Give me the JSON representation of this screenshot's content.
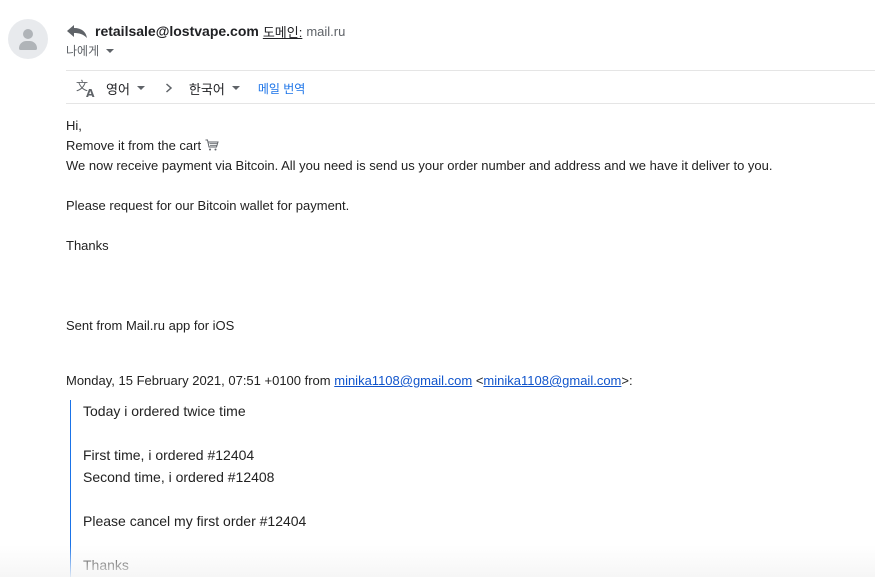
{
  "sender": {
    "email": "retailsale@lostvape.com",
    "domain_label": "도메인:",
    "domain_value": "mail.ru"
  },
  "recipient": {
    "label": "나에게"
  },
  "translate": {
    "source_lang": "영어",
    "target_lang": "한국어",
    "translate_link": "메일 번역"
  },
  "body": {
    "lines": [
      "Hi,",
      "Remove it from the cart",
      "We now receive payment via Bitcoin. All you need is send us your order number and address and we have it deliver to you.",
      "",
      "Please request for our Bitcoin wallet  for payment.",
      "",
      "Thanks",
      "",
      "",
      "",
      "Sent from Mail.ru app for iOS"
    ]
  },
  "quote_header": {
    "prefix": "Monday, 15 February 2021, 07:51 +0100 from ",
    "email_link": "minika1108@gmail.com",
    "middle": " <",
    "email_link2": "minika1108@gmail.com",
    "suffix": ">:"
  },
  "quoted": {
    "lines": [
      "Today i ordered twice time",
      "",
      "First time, i ordered #12404",
      "Second time, i ordered #12408",
      "",
      "Please cancel my first order #12404",
      "",
      "Thanks"
    ]
  },
  "colors": {
    "link": "#1155cc",
    "accent": "#1a73e8",
    "quote_bar": "#1a73e8"
  }
}
